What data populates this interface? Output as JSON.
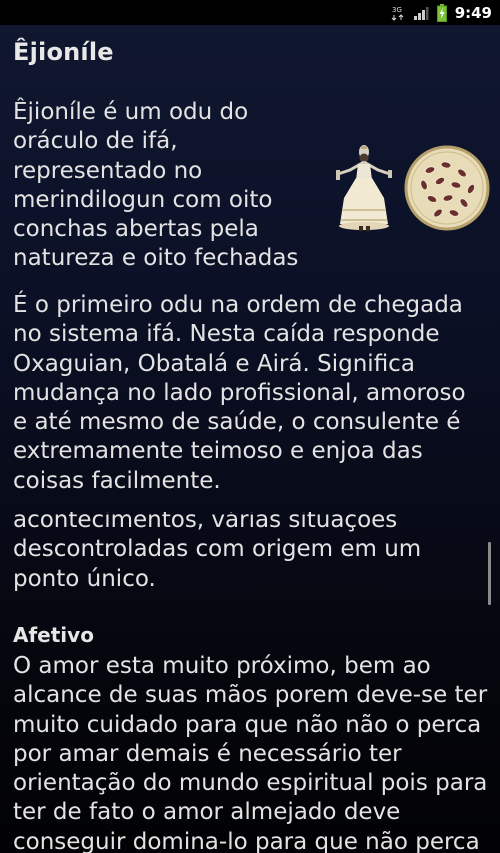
{
  "status_bar": {
    "network_label": "3G",
    "time": "9:49"
  },
  "page": {
    "title": "Êjioníle",
    "intro": "Êjioníle é um odu do oráculo de ifá, representado no merindilogun com oito conchas abertas pela natureza e oito fechadas",
    "paragraph_1": "É o primeiro odu na ordem de chegada no sistema ifá. Nesta caída responde Oxaguian, Obatalá e Airá. Significa mudança no lado profissional, amoroso e até mesmo de saúde, o consulente é extremamente teimoso e enjoa das coisas facilmente.",
    "paragraph_2": "acontecimentos, várias situações descontroladas com origem em um ponto único.",
    "section_heading": "Afetivo",
    "paragraph_3": "O amor esta muito próximo, bem ao alcance de suas mãos porem deve-se ter muito cuidado para que não não o perca por amar demais é necessário ter orientação do mundo espiritual pois para ter de fato o amor almejado deve conseguir domina-lo para que não perca"
  },
  "icons": {
    "network": "signal-bars-icon",
    "battery": "battery-charging-icon",
    "figure": "orisha-figure-image",
    "tray": "cowrie-tray-image"
  },
  "colors": {
    "background_top": "#101830",
    "background_bottom": "#020204",
    "text": "#e3e3e3",
    "battery": "#7cc13a"
  }
}
